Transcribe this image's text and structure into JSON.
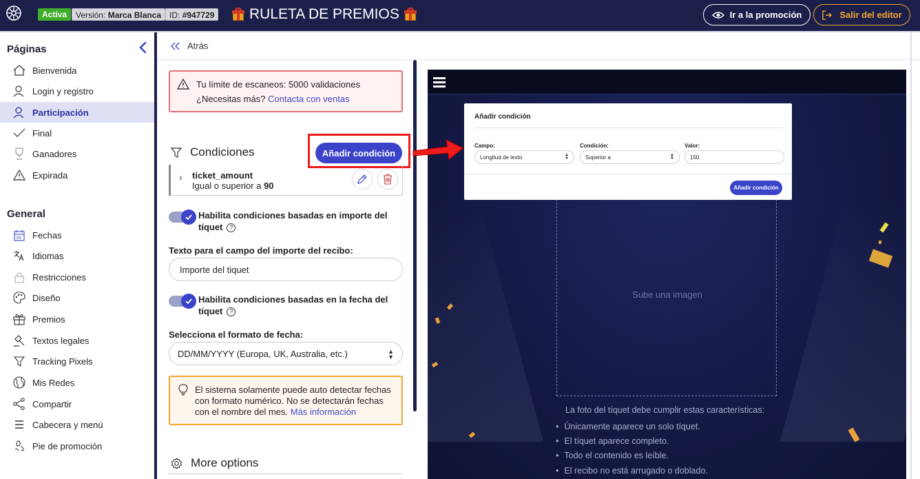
{
  "topbar": {
    "status_badge": "Activa",
    "version_prefix": "Versión:",
    "version_value": "Marca Blanca",
    "id_prefix": "ID:",
    "id_value": "#947729",
    "title": "RULETA DE PREMIOS",
    "promo_button": "Ir a la promoción",
    "exit_button": "Salir del editor"
  },
  "sidebar": {
    "pages_heading": "Páginas",
    "pages": [
      {
        "label": "Bienvenida",
        "icon": "home-icon"
      },
      {
        "label": "Login y registro",
        "icon": "user-icon"
      },
      {
        "label": "Participación",
        "icon": "user-icon",
        "active": true
      },
      {
        "label": "Final",
        "icon": "check-icon"
      },
      {
        "label": "Ganadores",
        "icon": "trophy-icon"
      },
      {
        "label": "Expirada",
        "icon": "warning-icon"
      }
    ],
    "general_heading": "General",
    "general": [
      {
        "label": "Fechas",
        "icon": "calendar-icon"
      },
      {
        "label": "Idiomas",
        "icon": "translate-icon"
      },
      {
        "label": "Restricciones",
        "icon": "lock-icon"
      },
      {
        "label": "Diseño",
        "icon": "palette-icon"
      },
      {
        "label": "Premios",
        "icon": "gift-icon"
      },
      {
        "label": "Textos legales",
        "icon": "gavel-icon"
      },
      {
        "label": "Tracking Pixels",
        "icon": "filter-icon"
      },
      {
        "label": "Mis Redes",
        "icon": "globe-icon"
      },
      {
        "label": "Compartir",
        "icon": "share-icon"
      },
      {
        "label": "Cabecera y menú",
        "icon": "menu-icon"
      },
      {
        "label": "Pie de promoción",
        "icon": "footer-icon"
      }
    ]
  },
  "editor": {
    "back_label": "Atrás",
    "alert_line1": "Tu límite de escaneos: 5000 validaciones",
    "alert_line2_prefix": "¿Necesitas más?",
    "alert_link": "Contacta con ventas",
    "conditions_title": "Condiciones",
    "add_condition_button": "Añadir condición",
    "condition": {
      "name": "ticket_amount",
      "desc_prefix": "Igual o superior a",
      "desc_value": "90"
    },
    "toggle_amount_label": "Habilita condiciones basadas en importe del tíquet",
    "amount_field_label": "Texto para el campo del importe del recibo:",
    "amount_field_value": "Importe del tiquet",
    "toggle_date_label": "Habilita condiciones basadas en la fecha del tíquet",
    "date_format_label": "Selecciona el formato de fecha:",
    "date_format_value": "DD/MM/YYYY (Europa, UK, Australia, etc.)",
    "note_text": "El sistema solamente puede auto detectar fechas con formato numérico. No se detectarán fechas con el nombre del mes.",
    "note_link": "Más información",
    "more_options": "More options"
  },
  "preview": {
    "upload_text": "Sube una imagen",
    "requirements_title": "La foto del tíquet debe cumplir estas características:",
    "requirements": [
      "Únicamente aparece un solo tíquet.",
      "El tíquet aparece completo.",
      "Todo el contenido es leíble.",
      "El recibo no está arrugado o doblado."
    ],
    "modal": {
      "title": "Añadir condición",
      "field_label": "Campo:",
      "field_value": "Longitud de texto",
      "condition_label": "Condición:",
      "condition_value": "Superior a",
      "value_label": "Valor:",
      "value_value": "150",
      "button": "Añadir condición"
    }
  },
  "colors": {
    "navy": "#1c1f4a",
    "accent": "#3b44c9",
    "active_green": "#3fae2a",
    "exit_orange": "#f0a830",
    "alert_red": "#e06f7a",
    "note_orange": "#f3a72e",
    "highlight_red": "#ee1c1c"
  }
}
